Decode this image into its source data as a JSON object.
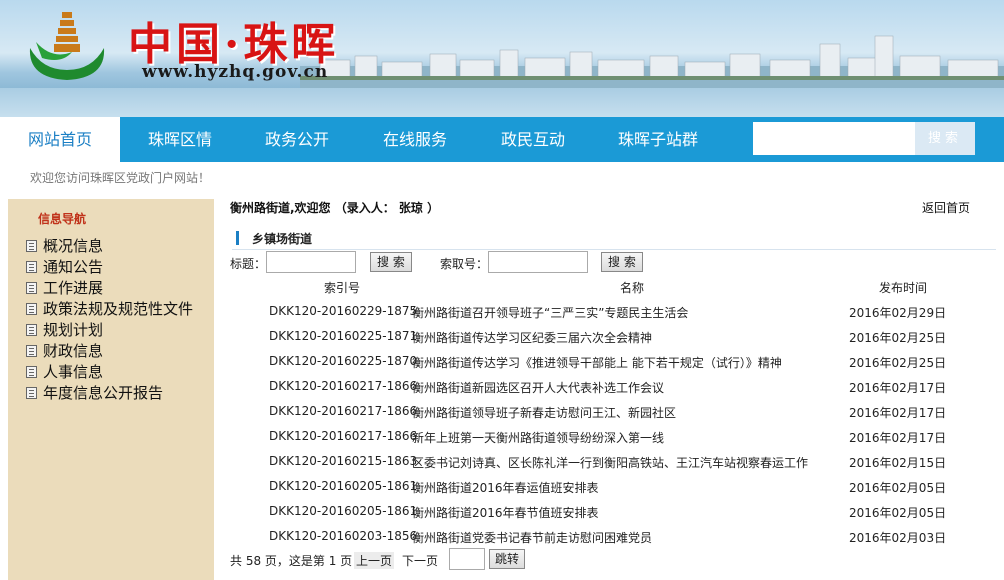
{
  "header": {
    "site_name": "中国·珠晖",
    "site_url": "www.hyzhq.gov.cn"
  },
  "nav": {
    "items": [
      {
        "label": "网站首页",
        "active": true
      },
      {
        "label": "珠晖区情",
        "active": false
      },
      {
        "label": "政务公开",
        "active": false
      },
      {
        "label": "在线服务",
        "active": false
      },
      {
        "label": "政民互动",
        "active": false
      },
      {
        "label": "珠晖子站群",
        "active": false
      }
    ],
    "search_value": "",
    "search_button": "搜索"
  },
  "welcome": "欢迎您访问珠晖区党政门户网站！",
  "sidebar": {
    "title": "信息导航",
    "items": [
      {
        "label": "概况信息",
        "icon": "document-icon"
      },
      {
        "label": "通知公告",
        "icon": "document-icon"
      },
      {
        "label": "工作进展",
        "icon": "document-icon"
      },
      {
        "label": "政策法规及规范性文件",
        "icon": "document-icon"
      },
      {
        "label": "规划计划",
        "icon": "document-icon"
      },
      {
        "label": "财政信息",
        "icon": "document-icon"
      },
      {
        "label": "人事信息",
        "icon": "document-icon"
      },
      {
        "label": "年度信息公开报告",
        "icon": "document-icon"
      }
    ]
  },
  "main": {
    "crumb": "衡州路街道,欢迎您 （录入人： 张琼 ）",
    "back_link": "返回首页",
    "section_title": "乡镇场街道",
    "filter": {
      "title_label": "标题：",
      "title_value": "",
      "search_button": "搜 索",
      "index_label": "索取号：",
      "index_value": "",
      "search_button_2": "搜 索"
    },
    "columns": {
      "index": "索引号",
      "name": "名称",
      "date": "发布时间"
    },
    "rows": [
      {
        "index": "DKK120-20160229-1875",
        "title": "衡州路街道召开领导班子“三严三实”专题民主生活会",
        "date": "2016年02月29日"
      },
      {
        "index": "DKK120-20160225-1871",
        "title": "衡州路街道传达学习区纪委三届六次全会精神",
        "date": "2016年02月25日"
      },
      {
        "index": "DKK120-20160225-1870",
        "title": "衡州路街道传达学习《推进领导干部能上 能下若干规定（试行）》精神",
        "date": "2016年02月25日"
      },
      {
        "index": "DKK120-20160217-1866",
        "title": "衡州路街道新园选区召开人大代表补选工作会议",
        "date": "2016年02月17日"
      },
      {
        "index": "DKK120-20160217-1866",
        "title": "衡州路街道领导班子新春走访慰问王江、新园社区",
        "date": "2016年02月17日"
      },
      {
        "index": "DKK120-20160217-1866",
        "title": "新年上班第一天衡州路街道领导纷纷深入第一线",
        "date": "2016年02月17日"
      },
      {
        "index": "DKK120-20160215-1863",
        "title": "区委书记刘诗真、区长陈礼洋一行到衡阳高铁站、王江汽车站视察春运工作",
        "date": "2016年02月15日"
      },
      {
        "index": "DKK120-20160205-1861",
        "title": "衡州路街道2016年春运值班安排表",
        "date": "2016年02月05日"
      },
      {
        "index": "DKK120-20160205-1861",
        "title": "衡州路街道2016年春节值班安排表",
        "date": "2016年02月05日"
      },
      {
        "index": "DKK120-20160203-1856",
        "title": "衡州路街道党委书记春节前走访慰问困难党员",
        "date": "2016年02月03日"
      }
    ],
    "pager": {
      "summary": "共 58 页，这是第 1 页",
      "prev": "上一页",
      "next": "下一页",
      "page_value": "",
      "jump": "跳转"
    }
  }
}
